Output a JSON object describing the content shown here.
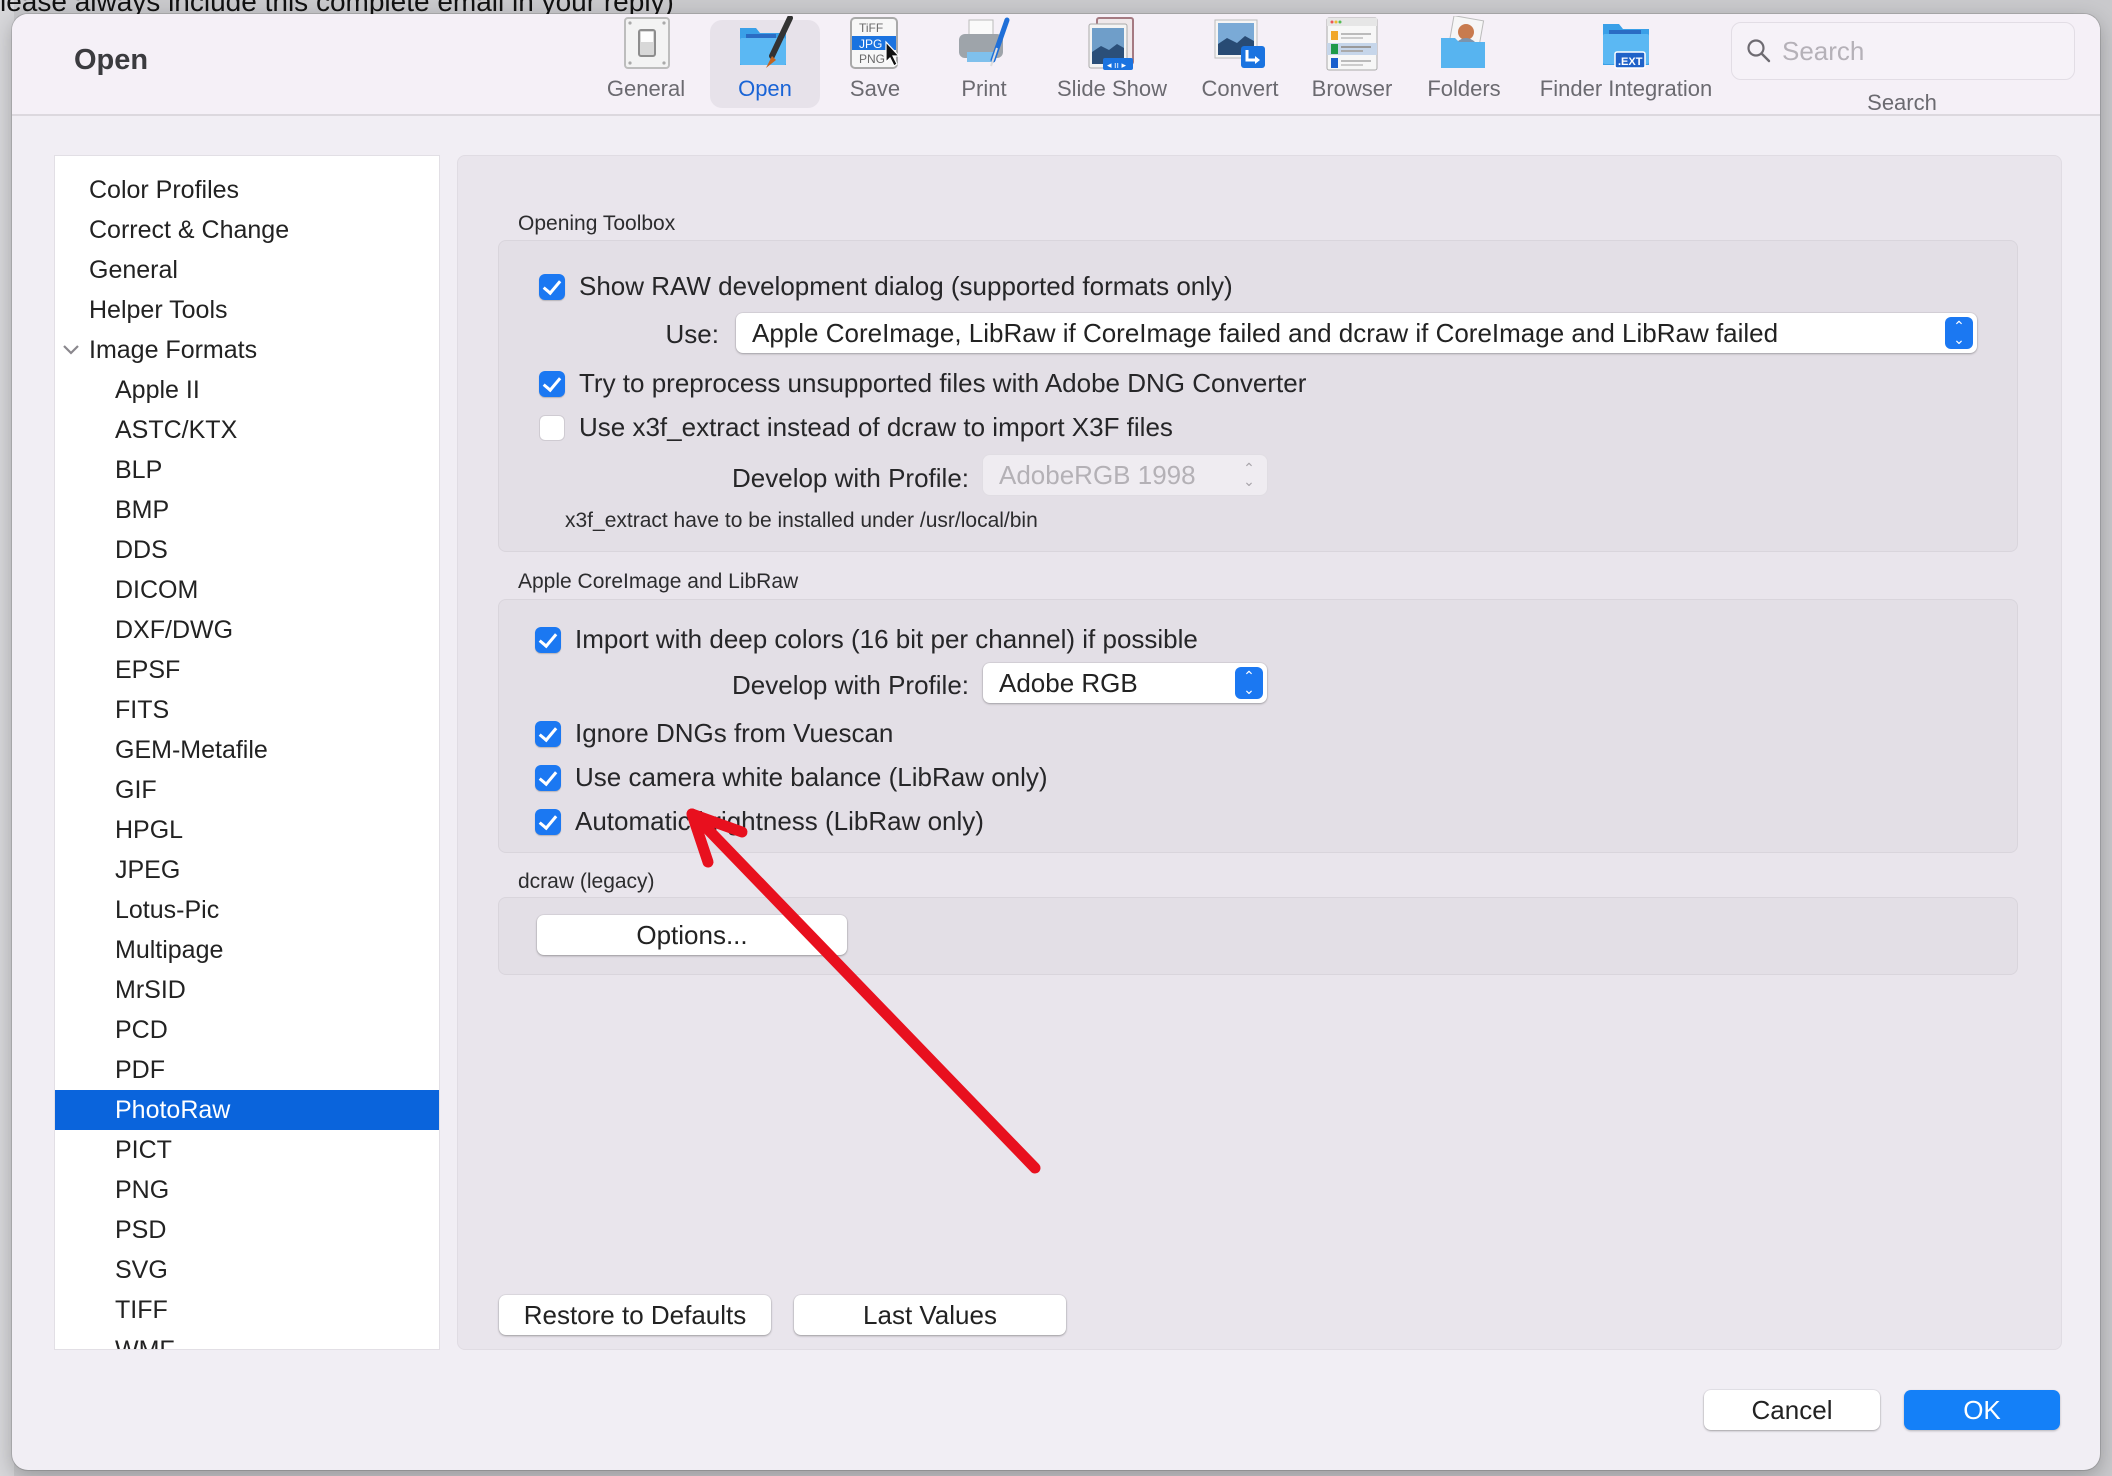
{
  "background": {
    "partial_text": "lease always include this complete email in your reply)"
  },
  "window": {
    "title": "Open"
  },
  "toolbar": {
    "items": [
      {
        "label": "General",
        "icon": "switch-panel-icon",
        "selected": false
      },
      {
        "label": "Open",
        "icon": "folder-paintbrush-icon",
        "selected": true
      },
      {
        "label": "Save",
        "icon": "file-formats-icon",
        "selected": false
      },
      {
        "label": "Print",
        "icon": "printer-icon",
        "selected": false
      },
      {
        "label": "Slide Show",
        "icon": "slideshow-icon",
        "selected": false
      },
      {
        "label": "Convert",
        "icon": "convert-icon",
        "selected": false
      },
      {
        "label": "Browser",
        "icon": "browser-icon",
        "selected": false
      },
      {
        "label": "Folders",
        "icon": "folders-icon",
        "selected": false
      },
      {
        "label": "Finder Integration",
        "icon": "finder-extension-icon",
        "selected": false
      }
    ],
    "save_icon_text": {
      "tiff": "TiFF",
      "jpg": "JPG",
      "png": "PNG"
    },
    "finder_icon_text": ".EXT",
    "search": {
      "placeholder": "Search",
      "value": "",
      "label": "Search"
    }
  },
  "sidebar": {
    "items": [
      {
        "label": "Color Profiles",
        "level": 0
      },
      {
        "label": "Correct & Change",
        "level": 0
      },
      {
        "label": "General",
        "level": 0
      },
      {
        "label": "Helper Tools",
        "level": 0
      },
      {
        "label": "Image Formats",
        "level": 0,
        "expanded": true
      },
      {
        "label": "Apple II",
        "level": 1
      },
      {
        "label": "ASTC/KTX",
        "level": 1
      },
      {
        "label": "BLP",
        "level": 1
      },
      {
        "label": "BMP",
        "level": 1
      },
      {
        "label": "DDS",
        "level": 1
      },
      {
        "label": "DICOM",
        "level": 1
      },
      {
        "label": "DXF/DWG",
        "level": 1
      },
      {
        "label": "EPSF",
        "level": 1
      },
      {
        "label": "FITS",
        "level": 1
      },
      {
        "label": "GEM-Metafile",
        "level": 1
      },
      {
        "label": "GIF",
        "level": 1
      },
      {
        "label": "HPGL",
        "level": 1
      },
      {
        "label": "JPEG",
        "level": 1
      },
      {
        "label": "Lotus-Pic",
        "level": 1
      },
      {
        "label": "Multipage",
        "level": 1
      },
      {
        "label": "MrSID",
        "level": 1
      },
      {
        "label": "PCD",
        "level": 1
      },
      {
        "label": "PDF",
        "level": 1
      },
      {
        "label": "PhotoRaw",
        "level": 1,
        "selected": true
      },
      {
        "label": "PICT",
        "level": 1
      },
      {
        "label": "PNG",
        "level": 1
      },
      {
        "label": "PSD",
        "level": 1
      },
      {
        "label": "SVG",
        "level": 1
      },
      {
        "label": "TIFF",
        "level": 1
      },
      {
        "label": "WMF",
        "level": 1
      }
    ]
  },
  "main": {
    "opening_toolbox": {
      "title": "Opening Toolbox",
      "show_raw_dialog": {
        "label": "Show RAW development dialog (supported formats only)",
        "checked": true
      },
      "use_label": "Use:",
      "use_value": "Apple CoreImage, LibRaw if CoreImage failed and dcraw if CoreImage and LibRaw failed",
      "preprocess_dng": {
        "label": "Try to preprocess unsupported files with Adobe DNG Converter",
        "checked": true
      },
      "use_x3f": {
        "label": "Use x3f_extract instead of dcraw to import X3F files",
        "checked": false
      },
      "profile_label": "Develop with Profile:",
      "profile_value": "AdobeRGB 1998",
      "profile_disabled": true,
      "note": "x3f_extract have to be installed under /usr/local/bin"
    },
    "coreimage_libraw": {
      "title": "Apple CoreImage and LibRaw",
      "deep_colors": {
        "label": "Import with deep colors (16 bit per channel) if possible",
        "checked": true
      },
      "profile_label": "Develop with Profile:",
      "profile_value": "Adobe RGB",
      "ignore_vuescan": {
        "label": "Ignore DNGs from Vuescan",
        "checked": true
      },
      "camera_wb": {
        "label": "Use camera white balance (LibRaw only)",
        "checked": true
      },
      "auto_brightness": {
        "label": "Automatic brightness (LibRaw only)",
        "checked": true
      }
    },
    "dcraw": {
      "title": "dcraw (legacy)",
      "options_button": "Options..."
    },
    "restore_defaults_button": "Restore to Defaults",
    "last_values_button": "Last Values"
  },
  "footer": {
    "cancel_button": "Cancel",
    "ok_button": "OK"
  },
  "annotation": {
    "type": "red-arrow",
    "color": "#e8101e",
    "points_to": "Automatic brightness (LibRaw only)"
  },
  "colors": {
    "accent": "#1b78f2",
    "selection": "#0a64dc",
    "ok_button": "#1480f8"
  }
}
